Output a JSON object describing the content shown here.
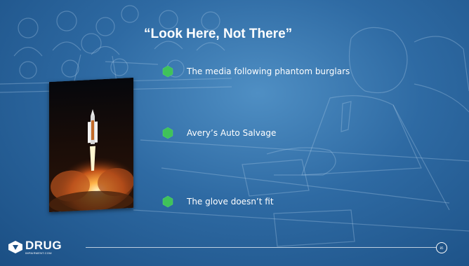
{
  "slide": {
    "title": "“Look Here, Not There”",
    "bullets": [
      {
        "text": "The media following phantom burglars"
      },
      {
        "text": "Avery’s Auto Salvage"
      },
      {
        "text": "The glove doesn’t fit"
      }
    ],
    "footer": {
      "brand": "DRUG",
      "brand_sub": "IMPAIRMENT.COM",
      "page_number": "85"
    },
    "colors": {
      "background": "#2e6aa3",
      "bullet_hex": "#3fc25a",
      "text": "#ffffff"
    }
  },
  "icons": {
    "bullet": "hexagon-bullet-icon",
    "logo": "drug-impairment-logo-icon"
  }
}
